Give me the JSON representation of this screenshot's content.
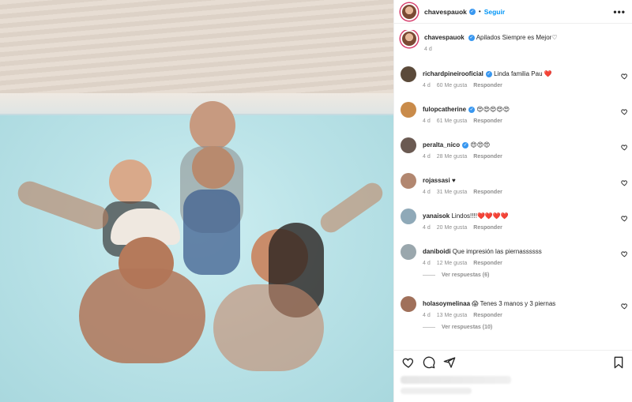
{
  "post": {
    "username": "chavespauok",
    "follow_label": "Seguir",
    "more_label": "•••",
    "caption": "Apilados Siempre es Mejor♡",
    "caption_time": "4 d"
  },
  "comments": [
    {
      "user": "richardpineirooficial",
      "verified": true,
      "text": "Linda familia Pau ❤️",
      "time": "4 d",
      "likes": "60 Me gusta",
      "reply": "Responder",
      "avatar_color": "#5b4a3a"
    },
    {
      "user": "fulopcatherine",
      "verified": true,
      "text": "😍😍😍😍😍",
      "time": "4 d",
      "likes": "61 Me gusta",
      "reply": "Responder",
      "avatar_color": "#c98b4a"
    },
    {
      "user": "peralta_nico",
      "verified": true,
      "text": "😍😍😍",
      "time": "4 d",
      "likes": "28 Me gusta",
      "reply": "Responder",
      "avatar_color": "#6b5a52"
    },
    {
      "user": "rojassasi",
      "verified": false,
      "text": "♥",
      "time": "4 d",
      "likes": "31 Me gusta",
      "reply": "Responder",
      "avatar_color": "#b28770"
    },
    {
      "user": "yanaisok",
      "verified": false,
      "text": "Lindos!!!!❤️❤️❤️❤️",
      "time": "4 d",
      "likes": "20 Me gusta",
      "reply": "Responder",
      "avatar_color": "#8fa9b8"
    },
    {
      "user": "daniboidi",
      "verified": false,
      "text": "Que impresión las piernassssss",
      "time": "4 d",
      "likes": "12 Me gusta",
      "reply": "Responder",
      "avatar_color": "#9aa7ad",
      "view_replies": "Ver respuestas (6)"
    },
    {
      "user": "holasoymelinaa",
      "verified": false,
      "text": "😱 Tenes 3 manos y 3 piernas",
      "time": "4 d",
      "likes": "13 Me gusta",
      "reply": "Responder",
      "avatar_color": "#a0705a",
      "view_replies": "Ver respuestas (10)"
    }
  ],
  "icons": {
    "like": "heart-icon",
    "comment": "comment-icon",
    "share": "share-icon",
    "save": "bookmark-icon"
  },
  "colors": {
    "accent": "#0095f6",
    "verified": "#3897f0",
    "muted": "#8e8e8e"
  }
}
